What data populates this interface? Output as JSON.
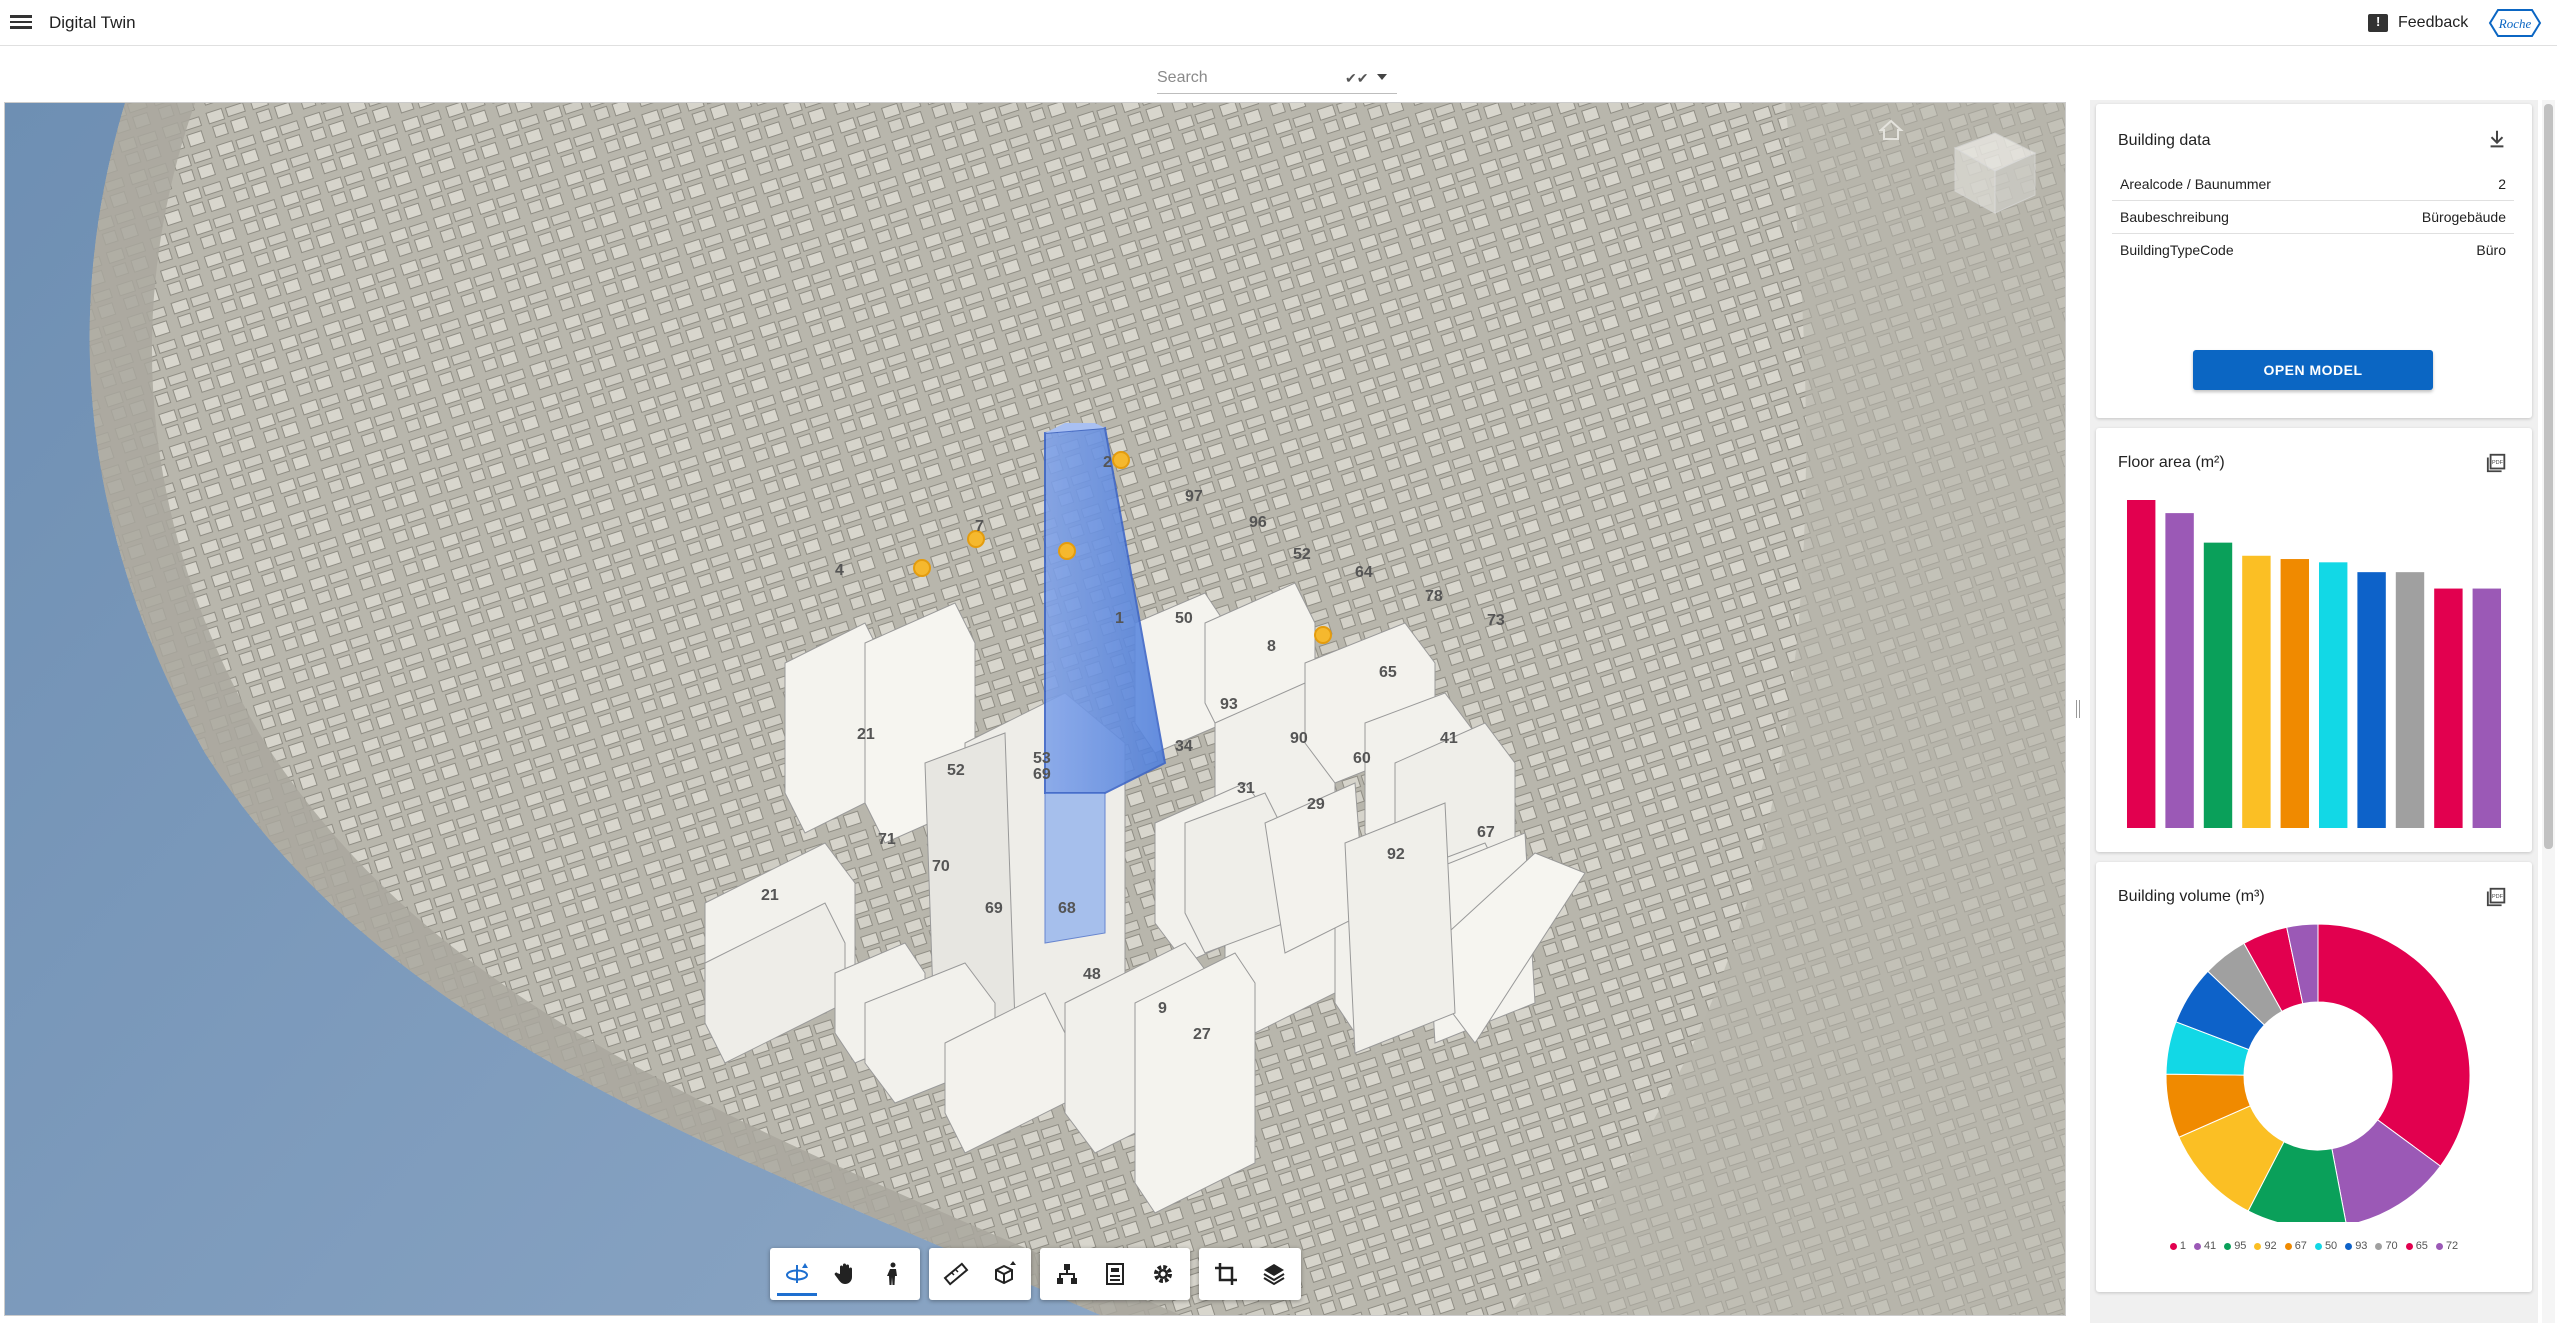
{
  "header": {
    "app_title": "Digital Twin",
    "feedback_label": "Feedback",
    "logo_text": "Roche"
  },
  "search": {
    "placeholder": "Search",
    "value": ""
  },
  "building_data": {
    "title": "Building data",
    "rows": [
      {
        "label": "Arealcode / Baunummer",
        "value": "2"
      },
      {
        "label": "Baubeschreibung",
        "value": "Bürogebäude"
      },
      {
        "label": "BuildingTypeCode",
        "value": "Büro"
      }
    ],
    "open_model_label": "OPEN MODEL"
  },
  "colors": {
    "accent": "#0b66c3",
    "series": [
      "#e2004f",
      "#9b59b6",
      "#0aa05a",
      "#fbbf24",
      "#f08a00",
      "#12d8e6",
      "#0d62c9",
      "#a0a0a0",
      "#e2004f",
      "#9b59b6"
    ]
  },
  "chart_data": [
    {
      "type": "bar",
      "title": "Floor area (m²)",
      "categories": [
        "1",
        "41",
        "95",
        "92",
        "67",
        "50",
        "93",
        "70",
        "65",
        "72"
      ],
      "values": [
        100,
        96,
        87,
        83,
        82,
        81,
        78,
        78,
        73,
        73
      ],
      "ylim": [
        0,
        100
      ],
      "grid": false,
      "legend": "none"
    },
    {
      "type": "pie",
      "title": "Building volume (m³)",
      "categories": [
        "1",
        "41",
        "95",
        "92",
        "67",
        "50",
        "93",
        "70",
        "65",
        "72"
      ],
      "values": [
        35.1,
        11.9,
        10.6,
        10.8,
        6.8,
        5.6,
        6.3,
        4.8,
        4.8,
        3.3
      ],
      "donut": true,
      "legend": "bottom"
    }
  ],
  "toolbar": {
    "groups": [
      [
        "orbit-icon",
        "pan-hand-icon",
        "walk-person-icon"
      ],
      [
        "measure-ruler-icon",
        "section-box-icon"
      ],
      [
        "model-tree-icon",
        "properties-icon",
        "settings-gear-icon"
      ],
      [
        "crop-icon",
        "layers-icon"
      ]
    ]
  },
  "map": {
    "icons": [
      "home-icon",
      "view-cube-icon"
    ],
    "labels": [
      "2",
      "97",
      "96",
      "52",
      "64",
      "78",
      "73",
      "4",
      "7",
      "1",
      "50",
      "69",
      "8",
      "65",
      "41",
      "93",
      "90",
      "60",
      "53",
      "52",
      "21",
      "34",
      "31",
      "29",
      "92",
      "21",
      "71",
      "70",
      "69",
      "68",
      "48",
      "9",
      "27",
      "67"
    ]
  }
}
